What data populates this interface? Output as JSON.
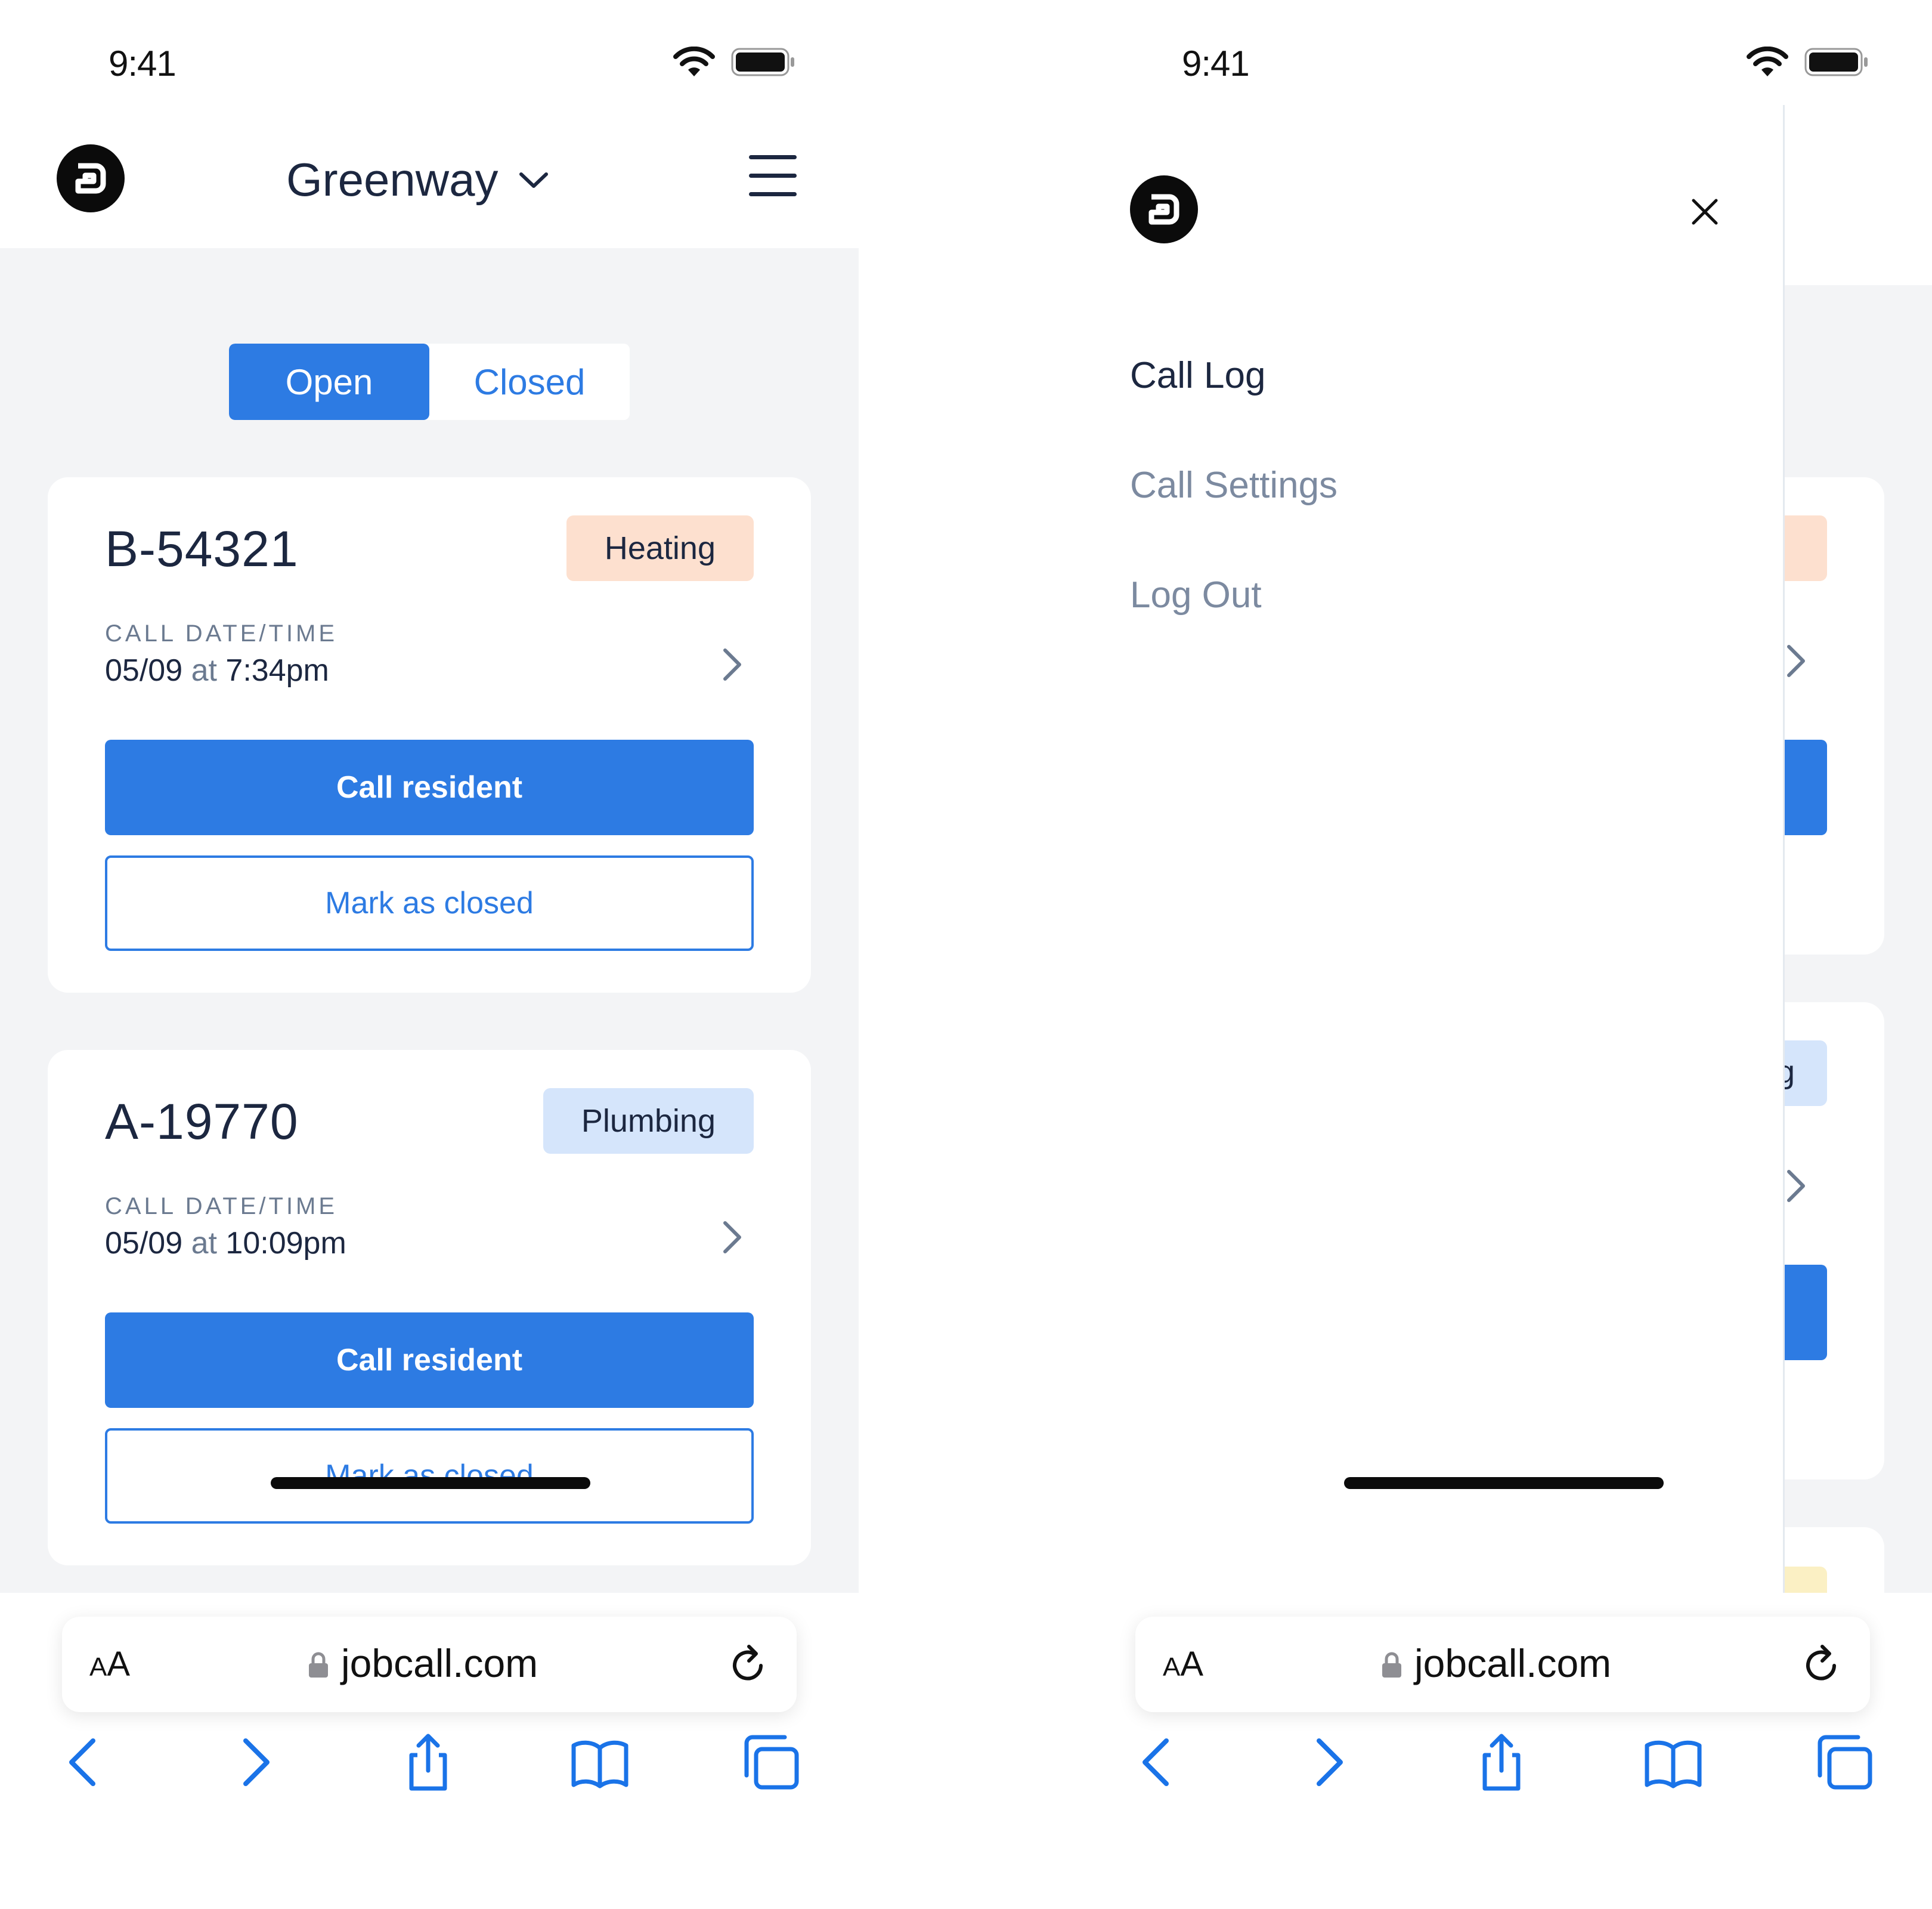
{
  "status": {
    "time": "9:41"
  },
  "header": {
    "brand": "Greenway"
  },
  "tabs": [
    {
      "label": "Open",
      "active": true
    },
    {
      "label": "Closed",
      "active": false
    }
  ],
  "cards": [
    {
      "id": "B-54321",
      "category": "Heating",
      "category_color": "#fde0cf",
      "date_label": "CALL DATE/TIME",
      "date": "05/09",
      "at": "at",
      "time": "7:34pm",
      "primary_label": "Call resident",
      "secondary_label": "Mark as closed"
    },
    {
      "id": "A-19770",
      "category": "Plumbing",
      "category_color": "#d5e5fb",
      "date_label": "CALL DATE/TIME",
      "date": "05/09",
      "at": "at",
      "time": "10:09pm",
      "primary_label": "Call resident",
      "secondary_label": "Mark as closed"
    }
  ],
  "browser": {
    "aa_small": "A",
    "aa_large": "A",
    "domain": "jobcall.com"
  },
  "drawer": {
    "items": [
      {
        "label": "Call Log",
        "active": true
      },
      {
        "label": "Call Settings",
        "active": false
      },
      {
        "label": "Log Out",
        "active": false
      }
    ],
    "peek_badge_text": "g"
  },
  "colors": {
    "accent": "#2d7be3",
    "text": "#1c2740",
    "muted": "#6b7a90",
    "bg": "#f3f4f6"
  }
}
